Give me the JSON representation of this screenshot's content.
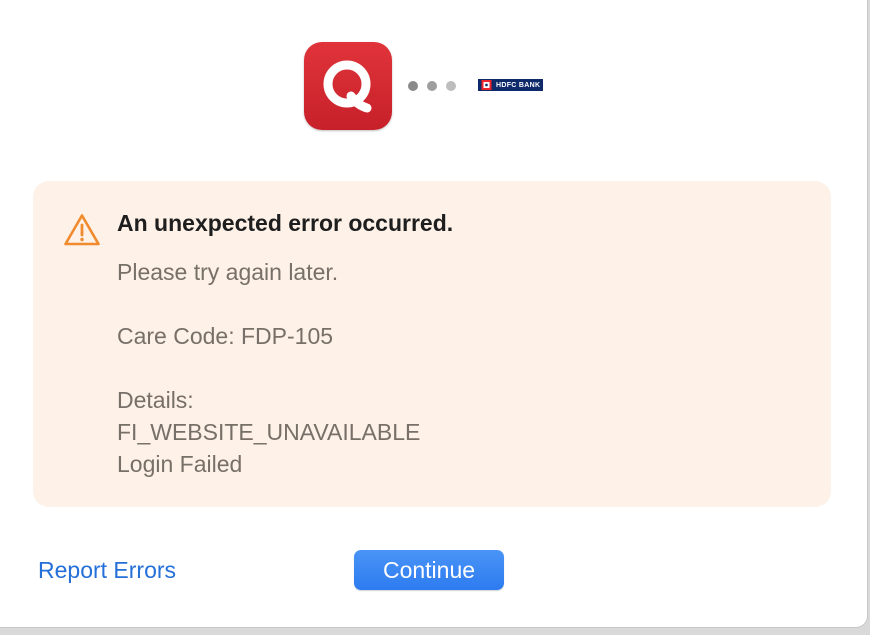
{
  "header": {
    "app_icon_name": "quicken-app-icon",
    "progress_dots": 3,
    "bank_logo": {
      "icon_name": "hdfc-bank-logo",
      "text": "HDFC BANK",
      "color": "#0f2a6b"
    }
  },
  "error": {
    "icon_name": "warning-icon",
    "title": "An unexpected error occurred.",
    "subtitle": "Please try again later.",
    "care_code": "Care Code: FDP-105",
    "details_label": "Details:",
    "detail_code": "FI_WEBSITE_UNAVAILABLE",
    "detail_message": "Login Failed",
    "panel_color": "#fdf1e8",
    "warning_color": "#f08a2c"
  },
  "footer": {
    "report_link": "Report Errors",
    "continue_button": "Continue",
    "accent_color": "#2d7bf0"
  }
}
